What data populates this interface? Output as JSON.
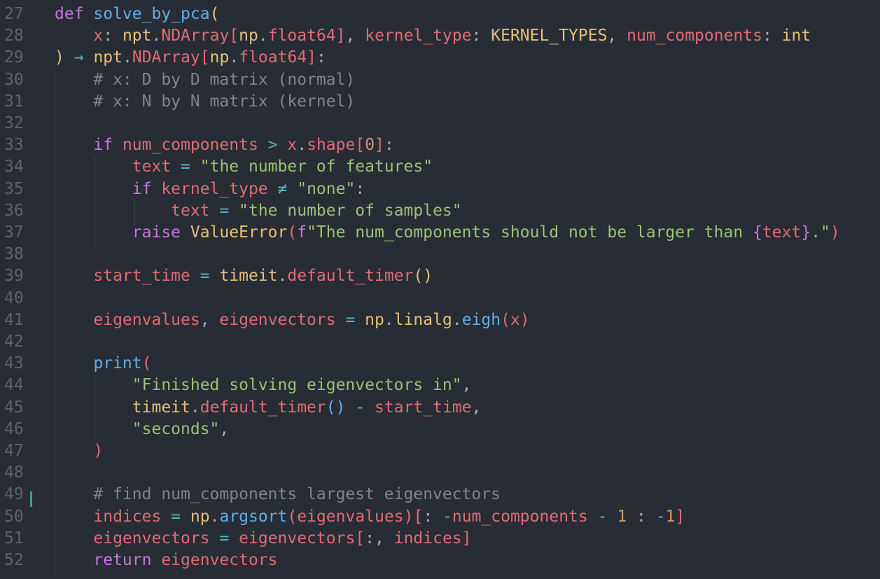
{
  "editor": {
    "language": "python",
    "colors": {
      "background": "#282c34",
      "keyword": "#c678dd",
      "function": "#61afef",
      "variable": "#e06c75",
      "type": "#e5c07b",
      "string": "#98c379",
      "comment": "#7f848e",
      "number": "#d19a66",
      "operator": "#56b6c2",
      "line_number": "#5c6370",
      "git_added": "#3ea377"
    },
    "lines": [
      {
        "n": "27",
        "tokens": [
          [
            "kw",
            "def "
          ],
          [
            "fn",
            "solve_by_pca"
          ],
          [
            "ty",
            "("
          ]
        ]
      },
      {
        "n": "28",
        "tokens": [
          [
            "pl",
            "    "
          ],
          [
            "var",
            "x"
          ],
          [
            "pl",
            ": "
          ],
          [
            "ty",
            "npt"
          ],
          [
            "pl",
            "."
          ],
          [
            "var",
            "NDArray"
          ],
          [
            "var",
            "["
          ],
          [
            "ty",
            "np"
          ],
          [
            "pl",
            "."
          ],
          [
            "var",
            "float64"
          ],
          [
            "var",
            "]"
          ],
          [
            "pl",
            ", "
          ],
          [
            "var",
            "kernel_type"
          ],
          [
            "pl",
            ": "
          ],
          [
            "ty",
            "KERNEL_TYPES"
          ],
          [
            "pl",
            ", "
          ],
          [
            "var",
            "num_components"
          ],
          [
            "pl",
            ": "
          ],
          [
            "ty",
            "int"
          ]
        ]
      },
      {
        "n": "29",
        "tokens": [
          [
            "ty",
            ")"
          ],
          [
            "pl",
            " "
          ],
          [
            "op",
            "→"
          ],
          [
            "pl",
            " "
          ],
          [
            "ty",
            "npt"
          ],
          [
            "pl",
            "."
          ],
          [
            "var",
            "NDArray"
          ],
          [
            "var",
            "["
          ],
          [
            "ty",
            "np"
          ],
          [
            "pl",
            "."
          ],
          [
            "var",
            "float64"
          ],
          [
            "var",
            "]"
          ],
          [
            "pl",
            ":"
          ]
        ]
      },
      {
        "n": "30",
        "tokens": [
          [
            "pl",
            "    "
          ],
          [
            "cm",
            "# x: D by D matrix (normal)"
          ]
        ]
      },
      {
        "n": "31",
        "tokens": [
          [
            "pl",
            "    "
          ],
          [
            "cm",
            "# x: N by N matrix (kernel)"
          ]
        ]
      },
      {
        "n": "32",
        "tokens": []
      },
      {
        "n": "33",
        "tokens": [
          [
            "pl",
            "    "
          ],
          [
            "kw",
            "if "
          ],
          [
            "var",
            "num_components"
          ],
          [
            "pl",
            " "
          ],
          [
            "op",
            ">"
          ],
          [
            "pl",
            " "
          ],
          [
            "var",
            "x"
          ],
          [
            "pl",
            "."
          ],
          [
            "var",
            "shape"
          ],
          [
            "var",
            "["
          ],
          [
            "num",
            "0"
          ],
          [
            "var",
            "]"
          ],
          [
            "pl",
            ":"
          ]
        ]
      },
      {
        "n": "34",
        "tokens": [
          [
            "pl",
            "        "
          ],
          [
            "var",
            "text"
          ],
          [
            "pl",
            " "
          ],
          [
            "op",
            "="
          ],
          [
            "pl",
            " "
          ],
          [
            "str",
            "\"the number of features\""
          ]
        ]
      },
      {
        "n": "35",
        "tokens": [
          [
            "pl",
            "        "
          ],
          [
            "kw",
            "if "
          ],
          [
            "var",
            "kernel_type"
          ],
          [
            "pl",
            " "
          ],
          [
            "op",
            "≠"
          ],
          [
            "pl",
            " "
          ],
          [
            "str",
            "\"none\""
          ],
          [
            "pl",
            ":"
          ]
        ]
      },
      {
        "n": "36",
        "tokens": [
          [
            "pl",
            "            "
          ],
          [
            "var",
            "text"
          ],
          [
            "pl",
            " "
          ],
          [
            "op",
            "="
          ],
          [
            "pl",
            " "
          ],
          [
            "str",
            "\"the number of samples\""
          ]
        ]
      },
      {
        "n": "37",
        "tokens": [
          [
            "pl",
            "        "
          ],
          [
            "kw",
            "raise "
          ],
          [
            "ty",
            "ValueError"
          ],
          [
            "var",
            "("
          ],
          [
            "kw",
            "f"
          ],
          [
            "str",
            "\"The num_components should not be larger than "
          ],
          [
            "kw",
            "{"
          ],
          [
            "var",
            "text"
          ],
          [
            "kw",
            "}"
          ],
          [
            "str",
            ".\""
          ],
          [
            "var",
            ")"
          ]
        ]
      },
      {
        "n": "38",
        "tokens": []
      },
      {
        "n": "39",
        "tokens": [
          [
            "pl",
            "    "
          ],
          [
            "var",
            "start_time"
          ],
          [
            "pl",
            " "
          ],
          [
            "op",
            "="
          ],
          [
            "pl",
            " "
          ],
          [
            "ty",
            "timeit"
          ],
          [
            "pl",
            "."
          ],
          [
            "var",
            "default_timer"
          ],
          [
            "ty",
            "()"
          ]
        ]
      },
      {
        "n": "40",
        "tokens": []
      },
      {
        "n": "41",
        "tokens": [
          [
            "pl",
            "    "
          ],
          [
            "var",
            "eigenvalues"
          ],
          [
            "pl",
            ", "
          ],
          [
            "var",
            "eigenvectors"
          ],
          [
            "pl",
            " "
          ],
          [
            "op",
            "="
          ],
          [
            "pl",
            " "
          ],
          [
            "ty",
            "np"
          ],
          [
            "pl",
            "."
          ],
          [
            "ty",
            "linalg"
          ],
          [
            "pl",
            "."
          ],
          [
            "fn",
            "eigh"
          ],
          [
            "var",
            "("
          ],
          [
            "var",
            "x"
          ],
          [
            "var",
            ")"
          ]
        ]
      },
      {
        "n": "42",
        "tokens": []
      },
      {
        "n": "43",
        "tokens": [
          [
            "pl",
            "    "
          ],
          [
            "fn",
            "print"
          ],
          [
            "var",
            "("
          ]
        ]
      },
      {
        "n": "44",
        "tokens": [
          [
            "pl",
            "        "
          ],
          [
            "str",
            "\"Finished solving eigenvectors in\""
          ],
          [
            "pl",
            ","
          ]
        ]
      },
      {
        "n": "45",
        "tokens": [
          [
            "pl",
            "        "
          ],
          [
            "ty",
            "timeit"
          ],
          [
            "pl",
            "."
          ],
          [
            "var",
            "default_timer"
          ],
          [
            "fn",
            "()"
          ],
          [
            "pl",
            " "
          ],
          [
            "op",
            "-"
          ],
          [
            "pl",
            " "
          ],
          [
            "var",
            "start_time"
          ],
          [
            "pl",
            ","
          ]
        ]
      },
      {
        "n": "46",
        "tokens": [
          [
            "pl",
            "        "
          ],
          [
            "str",
            "\"seconds\""
          ],
          [
            "pl",
            ","
          ]
        ]
      },
      {
        "n": "47",
        "tokens": [
          [
            "pl",
            "    "
          ],
          [
            "var",
            ")"
          ]
        ]
      },
      {
        "n": "48",
        "tokens": []
      },
      {
        "n": "49",
        "tokens": [
          [
            "pl",
            "    "
          ],
          [
            "cm",
            "# find num_components largest eigenvectors"
          ]
        ]
      },
      {
        "n": "50",
        "tokens": [
          [
            "pl",
            "    "
          ],
          [
            "var",
            "indices"
          ],
          [
            "pl",
            " "
          ],
          [
            "op",
            "="
          ],
          [
            "pl",
            " "
          ],
          [
            "ty",
            "np"
          ],
          [
            "pl",
            "."
          ],
          [
            "fn",
            "argsort"
          ],
          [
            "var",
            "("
          ],
          [
            "var",
            "eigenvalues"
          ],
          [
            "var",
            ")"
          ],
          [
            "var",
            "["
          ],
          [
            "pl",
            ": "
          ],
          [
            "op",
            "-"
          ],
          [
            "var",
            "num_components"
          ],
          [
            "pl",
            " "
          ],
          [
            "op",
            "-"
          ],
          [
            "pl",
            " "
          ],
          [
            "num",
            "1"
          ],
          [
            "pl",
            " : "
          ],
          [
            "op",
            "-"
          ],
          [
            "num",
            "1"
          ],
          [
            "var",
            "]"
          ]
        ]
      },
      {
        "n": "51",
        "tokens": [
          [
            "pl",
            "    "
          ],
          [
            "var",
            "eigenvectors"
          ],
          [
            "pl",
            " "
          ],
          [
            "op",
            "="
          ],
          [
            "pl",
            " "
          ],
          [
            "var",
            "eigenvectors"
          ],
          [
            "var",
            "["
          ],
          [
            "pl",
            ":, "
          ],
          [
            "var",
            "indices"
          ],
          [
            "var",
            "]"
          ]
        ]
      },
      {
        "n": "52",
        "tokens": [
          [
            "pl",
            "    "
          ],
          [
            "kw",
            "return "
          ],
          [
            "var",
            "eigenvectors"
          ]
        ]
      }
    ]
  }
}
